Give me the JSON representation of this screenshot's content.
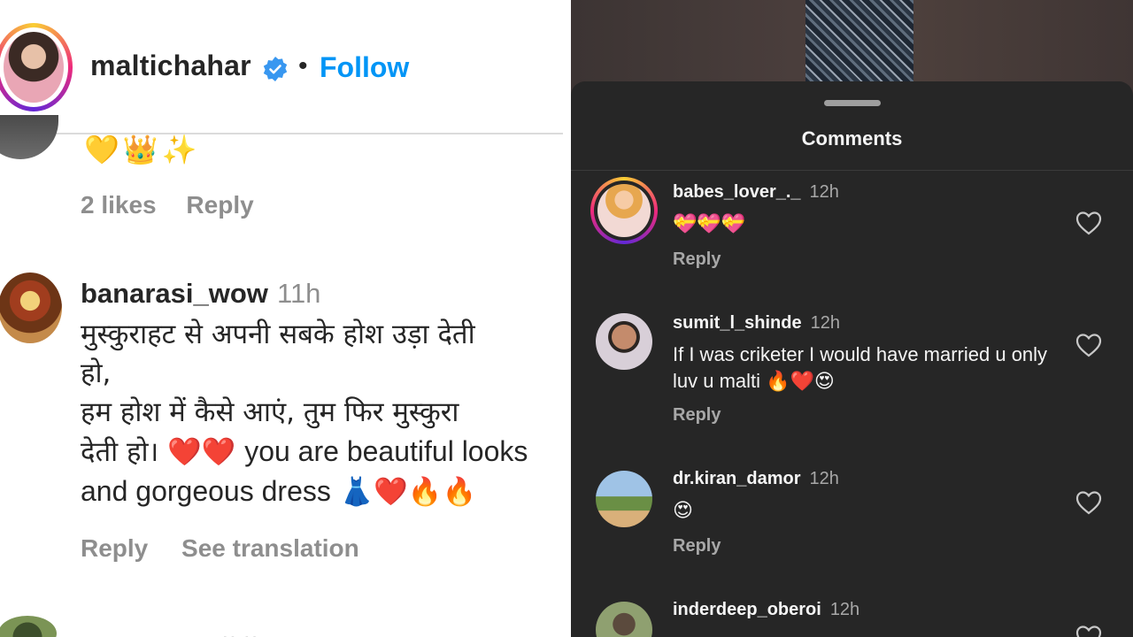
{
  "left": {
    "header": {
      "username": "maltichahar",
      "separator": "•",
      "follow_label": "Follow"
    },
    "prev_comment": {
      "emojis": "💛👑✨",
      "likes": "2 likes",
      "reply": "Reply"
    },
    "comment": {
      "username": "banarasi_wow",
      "time": "11h",
      "line1": "मुस्कुराहट से अपनी सबके होश उड़ा देती",
      "line2": "हो,",
      "line3": "हम होश में कैसे आएं, तुम फिर मुस्कुरा",
      "line4_hi": "देती हो।",
      "line4_emoji": "❤️❤️",
      "line4_en": "you are beautiful looks",
      "line5": "and gorgeous dress",
      "line5_emoji": "👗❤️🔥🔥",
      "reply": "Reply",
      "see_translation": "See translation"
    },
    "next_partial": "·· ··"
  },
  "right": {
    "title": "Comments",
    "comments": [
      {
        "username": "babes_lover_._",
        "time": "12h",
        "text": "💝💝💝",
        "reply": "Reply"
      },
      {
        "username": "sumit_l_shinde",
        "time": "12h",
        "text": "If I was criketer I would have married u only luv u malti 🔥❤️😍",
        "reply": "Reply"
      },
      {
        "username": "dr.kiran_damor",
        "time": "12h",
        "text": "😍",
        "reply": "Reply"
      },
      {
        "username": "inderdeep_oberoi",
        "time": "12h"
      }
    ]
  },
  "colors": {
    "follow_blue": "#0095f6",
    "dark_bg": "#262626",
    "muted_gray": "#8e8e8e"
  }
}
